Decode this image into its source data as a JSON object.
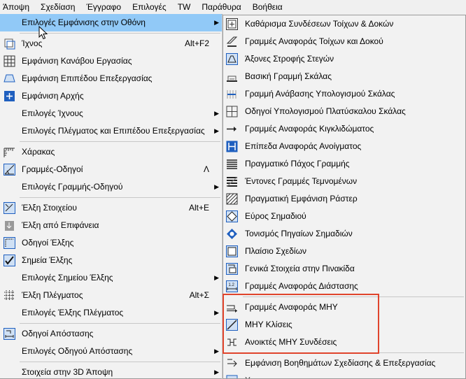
{
  "menubar": [
    "Άποψη",
    "Σχεδίαση",
    "Έγγραφο",
    "Επιλογές",
    "TW",
    "Παράθυρα",
    "Βοήθεια"
  ],
  "left_menu": [
    {
      "label": "Επιλογές Εμφάνισης στην Οθόνη",
      "submenu": true,
      "highlighted": true,
      "icon": "none-icon"
    },
    {
      "sep": true
    },
    {
      "label": "Ίχνος",
      "shortcut": "Alt+F2",
      "icon": "trace-icon"
    },
    {
      "label": "Εμφάνιση Κανάβου Εργασίας",
      "icon": "grid-icon"
    },
    {
      "label": "Εμφάνιση Επιπέδου Επεξεργασίας",
      "icon": "plane-icon"
    },
    {
      "label": "Εμφάνιση Αρχής",
      "icon": "origin-icon"
    },
    {
      "label": "Επιλογές Ίχνους",
      "submenu": true,
      "icon": "none-icon"
    },
    {
      "label": "Επιλογές Πλέγματος και Επιπέδου Επεξεργασίας",
      "submenu": true,
      "icon": "none-icon"
    },
    {
      "sep": true
    },
    {
      "label": "Χάρακας",
      "icon": "ruler-icon"
    },
    {
      "label": "Γραμμές-Οδηγοί",
      "shortcut": "Λ",
      "icon": "guide-lines-icon"
    },
    {
      "label": "Επιλογές Γραμμής-Οδηγού",
      "submenu": true,
      "icon": "none-icon"
    },
    {
      "sep": true
    },
    {
      "label": "Έλξη Στοιχείου",
      "shortcut": "Alt+E",
      "icon": "element-snap-icon"
    },
    {
      "label": "Έλξη από Επιφάνεια",
      "icon": "surface-snap-icon"
    },
    {
      "label": "Οδηγοί Έλξης",
      "icon": "snap-guides-icon"
    },
    {
      "label": "Σημεία Έλξης",
      "icon": "snap-points-icon"
    },
    {
      "label": "Επιλογές Σημείου Έλξης",
      "submenu": true,
      "icon": "none-icon"
    },
    {
      "label": "Έλξη Πλέγματος",
      "shortcut": "Alt+Σ",
      "icon": "grid-snap-icon"
    },
    {
      "label": "Επιλογές Έλξης Πλέγματος",
      "submenu": true,
      "icon": "none-icon"
    },
    {
      "sep": true
    },
    {
      "label": "Οδηγοί Απόστασης",
      "icon": "distance-guides-icon"
    },
    {
      "label": "Επιλογές Οδηγού Απόστασης",
      "submenu": true,
      "icon": "none-icon"
    },
    {
      "sep": true
    },
    {
      "label": "Στοιχεία στην 3D Άποψη",
      "submenu": true,
      "icon": "none-icon"
    }
  ],
  "right_menu": [
    {
      "label": "Καθάρισμα Συνδέσεων Τοίχων & Δοκών",
      "icon": "clean-intersections-icon"
    },
    {
      "label": "Γραμμές Αναφοράς Τοίχων και Δοκού",
      "icon": "wall-reference-lines-icon"
    },
    {
      "label": "Άξονες Στροφής Στεγών",
      "icon": "roof-pivot-icon"
    },
    {
      "label": "Βασική Γραμμή Σκάλας",
      "icon": "stair-baseline-icon"
    },
    {
      "label": "Γραμμή Ανάβασης Υπολογισμού Σκάλας",
      "icon": "stair-walkline-icon"
    },
    {
      "label": "Οδηγοί Υπολογισμού Πλατύσκαλου Σκάλας",
      "icon": "landing-guides-icon"
    },
    {
      "label": "Γραμμές Αναφοράς Κιγκλιδώματος",
      "icon": "railing-reference-icon"
    },
    {
      "label": "Επίπεδα Αναφοράς Ανοίγματος",
      "icon": "opening-reference-icon"
    },
    {
      "label": "Πραγματικό Πάχος Γραμμής",
      "icon": "true-line-weight-icon"
    },
    {
      "label": "Έντονες Γραμμές Τεμνομένων",
      "icon": "bold-cut-lines-icon"
    },
    {
      "label": "Πραγματική Εμφάνιση Ράστερ",
      "icon": "vectorial-hatching-icon"
    },
    {
      "label": "Εύρος Σημαδιού",
      "icon": "marker-range-icon"
    },
    {
      "label": "Τονισμός Πηγαίων Σημαδιών",
      "icon": "source-markers-icon"
    },
    {
      "label": "Πλαίσιο Σχεδίων",
      "icon": "drawing-frames-icon"
    },
    {
      "label": "Γενικά Στοιχεία στην Πινακίδα",
      "icon": "title-autotext-icon"
    },
    {
      "label": "Γραμμές Αναφοράς Διάστασης",
      "icon": "dimension-reference-icon"
    },
    {
      "sep": true
    },
    {
      "label": "Γραμμές Αναφοράς ΜΗΥ",
      "icon": "mep-reference-lines-icon"
    },
    {
      "label": "ΜΗΥ Κλίσεις",
      "icon": "mep-slopes-icon"
    },
    {
      "label": "Ανοικτές ΜΗΥ Συνδέσεις",
      "icon": "mep-open-connections-icon"
    },
    {
      "sep": true
    },
    {
      "label": "Εμφάνιση Βοηθημάτων Σχεδίασης & Επεξεργασίας",
      "icon": "drafting-aids-icon"
    },
    {
      "label": "Χ",
      "icon": "partial-icon"
    }
  ],
  "colors": {
    "highlight": "#91c9f7",
    "accent_blue": "#1f5fbf",
    "annotation_red": "#e0442c"
  }
}
